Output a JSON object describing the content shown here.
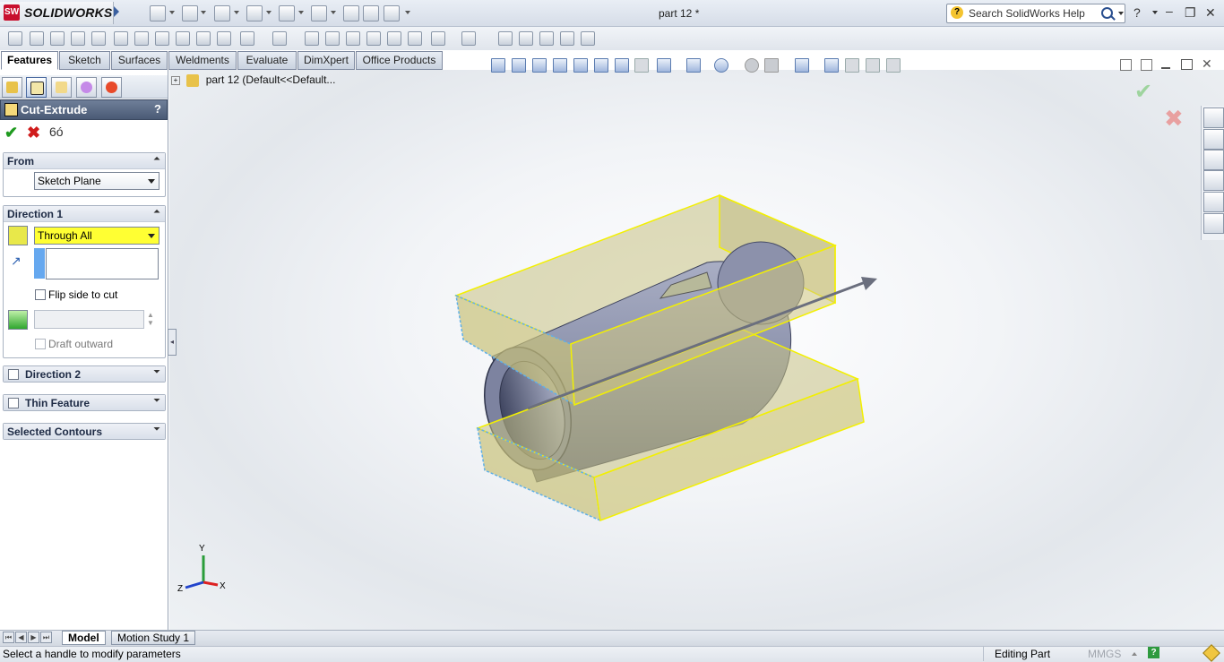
{
  "app": {
    "logo_text": "SOLIDWORKS",
    "logo_badge": "SW",
    "document_title": "part 12 *"
  },
  "search": {
    "placeholder": "Search SolidWorks Help"
  },
  "window_controls": [
    "?",
    "–",
    "❐",
    "✕"
  ],
  "tabs": [
    {
      "label": "Features",
      "active": true
    },
    {
      "label": "Sketch"
    },
    {
      "label": "Surfaces"
    },
    {
      "label": "Weldments"
    },
    {
      "label": "Evaluate"
    },
    {
      "label": "DimXpert"
    },
    {
      "label": "Office Products"
    }
  ],
  "feature": {
    "title": "Cut-Extrude",
    "help": "?",
    "ok": "✔",
    "cancel": "✖",
    "preview": "6ó"
  },
  "from_group": {
    "title": "From",
    "value": "Sketch Plane"
  },
  "direction1": {
    "title": "Direction 1",
    "end_condition": "Through All",
    "flip_label": "Flip side to cut",
    "draft_label": "Draft outward"
  },
  "direction2": {
    "title": "Direction 2"
  },
  "thin_feature": {
    "title": "Thin Feature"
  },
  "selected_contours": {
    "title": "Selected Contours"
  },
  "tree": {
    "expand": "+",
    "item": "part 12  (Default<<Default..."
  },
  "triad": {
    "x": "X",
    "y": "Y",
    "z": "Z"
  },
  "bottom_tabs": [
    {
      "label": "Model",
      "active": true
    },
    {
      "label": "Motion Study 1"
    }
  ],
  "status": {
    "message": "Select a handle to modify parameters",
    "mode": "Editing Part",
    "units": "MMGS",
    "help_badge": "?"
  },
  "colors": {
    "accent": "#3a5f9f",
    "highlight": "#ffff33",
    "preview_fill": "#c9c27a",
    "preview_edge": "#f3f000"
  }
}
